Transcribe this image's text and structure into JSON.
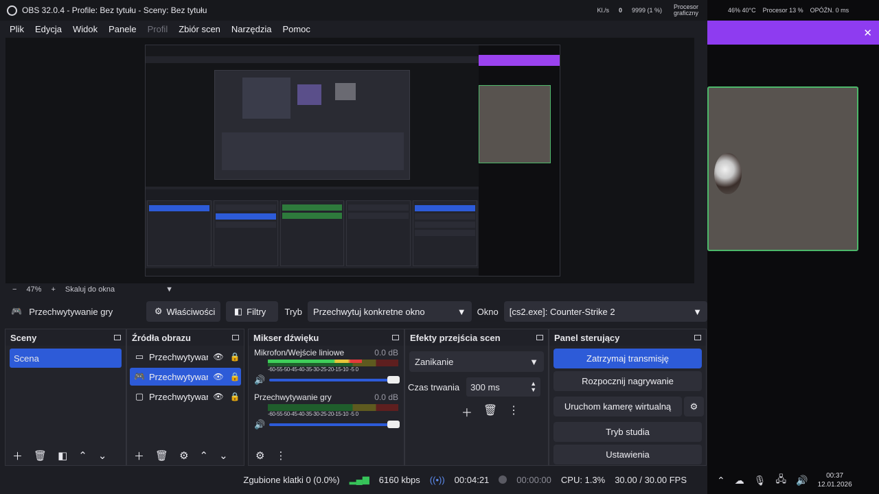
{
  "titlebar": {
    "title": "OBS 32.0.4 - Profile: Bez tytułu - Sceny: Bez tytułu",
    "stat_net": "Kl./s",
    "stat_net_val": "0",
    "stat_cpu": "9999 (1 %)",
    "stat_gpu": "Procesor graficzny"
  },
  "menu": [
    "Plik",
    "Edycja",
    "Widok",
    "Panele",
    "Profil",
    "Zbiór scen",
    "Narzędzia",
    "Pomoc"
  ],
  "zoom": {
    "minus": "−",
    "value": "47%",
    "plus": "+",
    "mode": "Skaluj do okna"
  },
  "source_toolbar": {
    "source_name": "Przechwytywanie gry",
    "properties": "Właściwości",
    "filters": "Filtry",
    "mode_label": "Tryb",
    "mode_value": "Przechwytuj konkretne okno",
    "window_label": "Okno",
    "window_value": "[cs2.exe]: Counter-Strike 2"
  },
  "scenes": {
    "title": "Sceny",
    "items": [
      "Scena"
    ]
  },
  "sources": {
    "title": "Źródła obrazu",
    "items": [
      {
        "name": "Przechwytywar",
        "icon": "window-icon"
      },
      {
        "name": "Przechwytywar",
        "icon": "gamepad-icon"
      },
      {
        "name": "Przechwytywar",
        "icon": "monitor-icon"
      }
    ]
  },
  "mixer": {
    "title": "Mikser dźwięku",
    "ticks": "-60-55-50-45-40-35-30-25-20-15-10 -5 0",
    "channels": [
      {
        "name": "Mikrofon/Wejście liniowe",
        "db": "0.0 dB",
        "level": 0.72
      },
      {
        "name": "Przechwytywanie gry",
        "db": "0.0 dB",
        "level": 0.0
      }
    ]
  },
  "transitions": {
    "title": "Efekty przejścia scen",
    "type": "Zanikanie",
    "duration_label": "Czas trwania",
    "duration_value": "300 ms"
  },
  "controls": {
    "title": "Panel sterujący",
    "stop_stream": "Zatrzymaj transmisję",
    "start_record": "Rozpocznij nagrywanie",
    "virtual_cam": "Uruchom kamerę wirtualną",
    "studio_mode": "Tryb studia",
    "settings": "Ustawienia"
  },
  "status": {
    "dropped": "Zgubione klatki 0 (0.0%)",
    "bitrate": "6160 kbps",
    "stream_time": "00:04:21",
    "record_time": "00:00:00",
    "cpu": "CPU: 1.3%",
    "fps": "30.00 / 30.00 FPS"
  },
  "overlay": {
    "top_stats": "46% 40°C",
    "cpu": "Procesor 13 %",
    "delay": "OPÓŹN. 0 ms"
  },
  "tray": {
    "time": "00:37",
    "date": "12.01.2026"
  },
  "colors": {
    "accent": "#2d5bd8",
    "purple": "#8e3cf0",
    "green_border": "#4db86a"
  }
}
